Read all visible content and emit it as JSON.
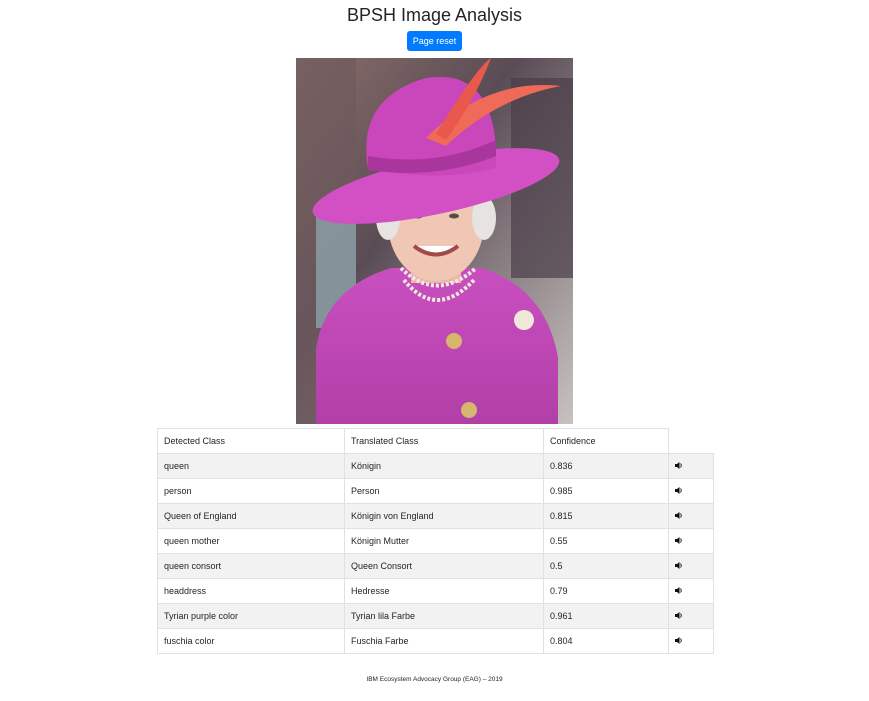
{
  "page": {
    "title": "BPSH Image Analysis",
    "reset_label": "Page reset",
    "footer": "IBM Ecosystem Advocacy Group (EAG) – 2019"
  },
  "photo": {
    "subject": "Queen Elizabeth II in magenta hat and coat"
  },
  "table": {
    "headers": [
      "Detected Class",
      "Translated Class",
      "Confidence"
    ],
    "rows": [
      {
        "detected": "queen",
        "translated": "Königin",
        "confidence": "0.836"
      },
      {
        "detected": "person",
        "translated": "Person",
        "confidence": "0.985"
      },
      {
        "detected": "Queen of England",
        "translated": "Königin von England",
        "confidence": "0.815"
      },
      {
        "detected": "queen mother",
        "translated": "Königin Mutter",
        "confidence": "0.55"
      },
      {
        "detected": "queen consort",
        "translated": "Queen Consort",
        "confidence": "0.5"
      },
      {
        "detected": "headdress",
        "translated": "Hedresse",
        "confidence": "0.79"
      },
      {
        "detected": "Tyrian purple color",
        "translated": "Tyrian lila Farbe",
        "confidence": "0.961"
      },
      {
        "detected": "fuschia color",
        "translated": "Fuschia Farbe",
        "confidence": "0.804"
      }
    ]
  },
  "icons": {
    "play": "speaker-icon"
  },
  "colors": {
    "button": "#007bff",
    "stripe": "#f2f2f2",
    "border": "#dee2e6"
  }
}
